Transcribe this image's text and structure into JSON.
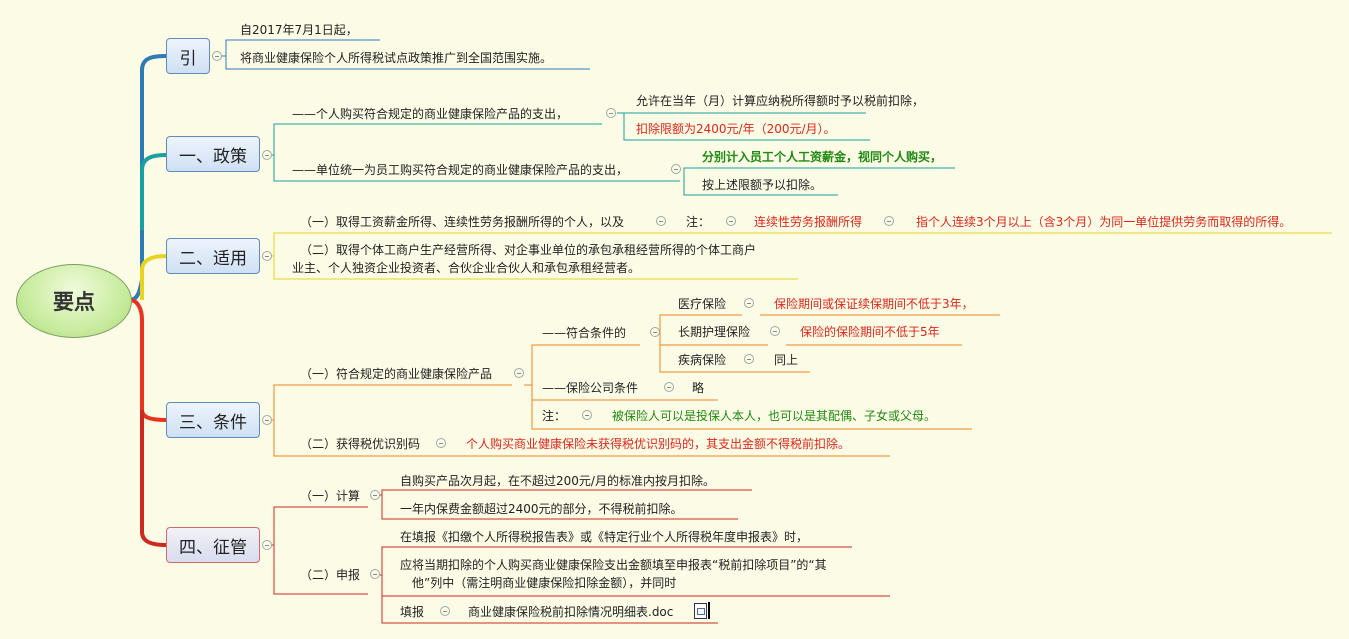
{
  "root": "要点",
  "intro": {
    "title": "引",
    "line1": "自2017年7月1日起，",
    "line2": "将商业健康保险个人所得税试点政策推广到全国范围实施。"
  },
  "policy": {
    "title": "一、政策",
    "personal": "——个人购买符合规定的商业健康保险产品的支出，",
    "personal_allow": "允许在当年（月）计算应纳税所得额时予以税前扣除，",
    "personal_limit": "扣除限额为2400元/年（200元/月）。",
    "unit": "——单位统一为员工购买符合规定的商业健康保险产品的支出，",
    "unit_calc": "分别计入员工个人工资薪金，视同个人购买，",
    "unit_limit": "按上述限额予以扣除。"
  },
  "apply": {
    "title": "二、适用",
    "item1": "（一）取得工资薪金所得、连续性劳务报酬所得的个人，以及",
    "note_label": "注：",
    "note_term": "连续性劳务报酬所得",
    "note_desc": "指个人连续3个月以上（含3个月）为同一单位提供劳务而取得的所得。",
    "item2_line1": "（二）取得个体工商户生产经营所得、对企事业单位的承包承租经营所得的个体工商户",
    "item2_line2": "业主、个人独资企业投资者、合伙企业合伙人和承包承租经营者。"
  },
  "conditions": {
    "title": "三、条件",
    "item1": "（一）符合规定的商业健康保险产品",
    "qualify": "——符合条件的",
    "medical": "医疗保险",
    "medical_note": "保险期间或保证续保期间不低于3年，",
    "ltc": "长期护理保险",
    "ltc_note": "保险的保险期间不低于5年",
    "illness": "疾病保险",
    "illness_note": "同上",
    "insurer": "——保险公司条件",
    "insurer_note": "略",
    "note_label": "注：",
    "note_text": "被保险人可以是投保人本人，也可以是其配偶、子女或父母。",
    "item2": "（二）获得税优识别码",
    "item2_note": "个人购买商业健康保险未获得税优识别码的，其支出金额不得税前扣除。"
  },
  "admin": {
    "title": "四、征管",
    "calc": "（一）计算",
    "calc_line1": "自购买产品次月起，在不超过200元/月的标准内按月扣除。",
    "calc_line2": "一年内保费金额超过2400元的部分，不得税前扣除。",
    "report": "（二）申报",
    "report_line1": "在填报《扣缴个人所得税报告表》或《特定行业个人所得税年度申报表》时，",
    "report_line2a": "应将当期扣除的个人购买商业健康保险支出金额填至申报表“税前扣除项目”的“其",
    "report_line2b": "他”列中（需注明商业健康保险扣除金额），并同时",
    "fill": "填报",
    "attachment": "商业健康保险税前扣除情况明细表.doc"
  },
  "colors": {
    "intro": "#2e7bb8",
    "policy": "#19a0a0",
    "apply": "#e8d420",
    "conditions": "#f0861d",
    "admin": "#cc2a1e"
  }
}
